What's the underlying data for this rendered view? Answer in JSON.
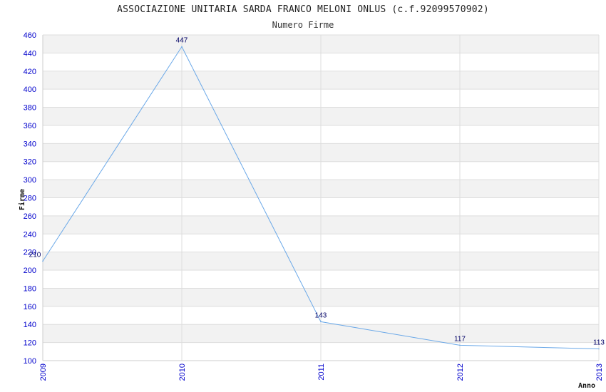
{
  "chart_data": {
    "type": "line",
    "title": "ASSOCIAZIONE UNITARIA SARDA FRANCO MELONI ONLUS (c.f.92099570902)",
    "subtitle": "Numero Firme",
    "xlabel": "Anno",
    "ylabel": "Firme",
    "categories": [
      "2009",
      "2010",
      "2011",
      "2012",
      "2013"
    ],
    "series": [
      {
        "values": [
          210,
          447,
          143,
          117,
          113
        ],
        "labels": [
          "210",
          "447",
          "143",
          "117",
          "113"
        ]
      }
    ],
    "ylim": [
      100,
      460
    ],
    "yticks": [
      "100",
      "120",
      "140",
      "160",
      "180",
      "200",
      "220",
      "240",
      "260",
      "280",
      "300",
      "320",
      "340",
      "360",
      "380",
      "400",
      "420",
      "440",
      "460"
    ],
    "grid": true,
    "line_color": "#6aa8e8",
    "band_color": "#f2f2f2"
  }
}
